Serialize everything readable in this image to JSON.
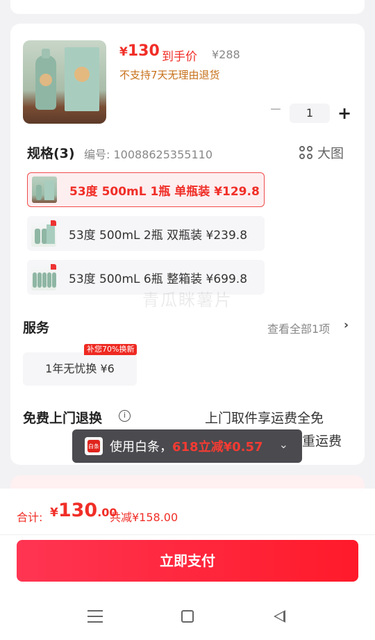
{
  "product": {
    "yen": "¥",
    "price": "130",
    "price_tag": "到手价",
    "original_price": "¥288",
    "return_policy": "不支持7天无理由退货"
  },
  "quantity": {
    "minus": "−",
    "value": "1",
    "plus": "+"
  },
  "spec": {
    "title": "规格(3)",
    "code": "编号: 10088625355110",
    "big_picture": "大图",
    "options": [
      {
        "label": "53度 500mL 1瓶 单瓶装  ¥129.8",
        "selected": true
      },
      {
        "label": "53度 500mL 2瓶 双瓶装  ¥239.8",
        "selected": false
      },
      {
        "label": "53度 500mL 6瓶 整箱装  ¥699.8",
        "selected": false
      }
    ]
  },
  "service": {
    "title": "服务",
    "view_all": "查看全部1项",
    "badge": "补您70%换新",
    "item": "1年无忧换  ¥6"
  },
  "free_return": {
    "title": "免费上门退换",
    "desc_line1": "上门取件享运费全免",
    "desc_line2": "重运费"
  },
  "toast": {
    "icon_text": "白条",
    "text": "使用白条，",
    "highlight": "618立减¥0.57"
  },
  "watermark": "青瓜眯薯片",
  "footer": {
    "total_label": "合计:",
    "total_yen": "¥",
    "total_int": "130",
    "total_dec": ".00",
    "discount": "共减¥158.00",
    "pay_button": "立即支付"
  }
}
